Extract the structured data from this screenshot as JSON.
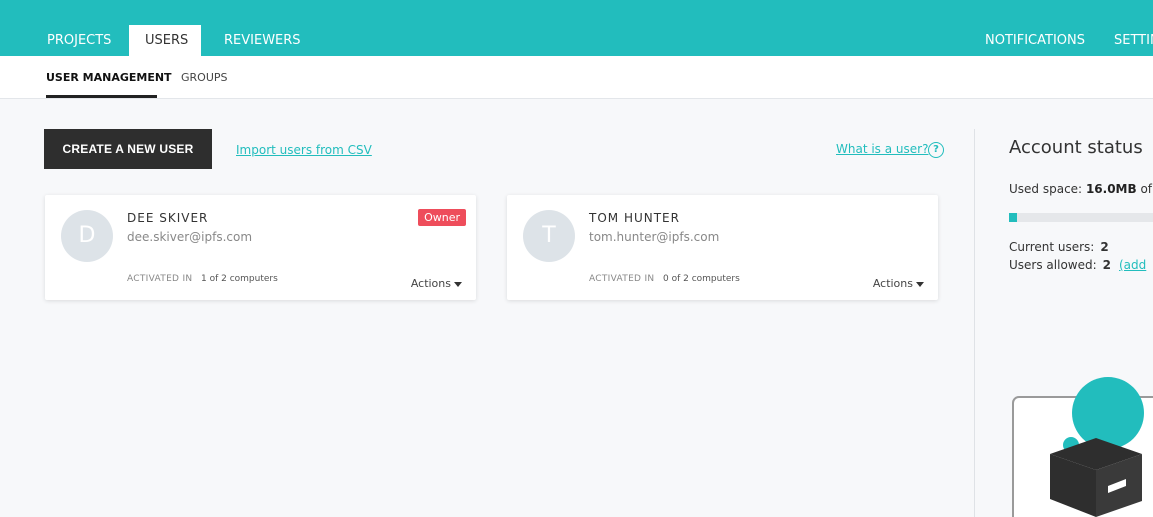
{
  "top_nav": {
    "tabs": [
      "PROJECTS",
      "USERS",
      "REVIEWERS"
    ],
    "active_tab": "USERS",
    "right_items": [
      "NOTIFICATIONS",
      "SETTIN"
    ]
  },
  "sub_nav": {
    "tabs": [
      "USER MANAGEMENT",
      "GROUPS"
    ],
    "active_tab": "USER MANAGEMENT"
  },
  "toolbar": {
    "create_label": "CREATE A NEW USER",
    "import_label": "Import users from CSV",
    "what_label": "What is a user?",
    "help_glyph": "?"
  },
  "users": [
    {
      "initial": "D",
      "name": "DEE SKIVER",
      "email": "dee.skiver@ipfs.com",
      "badge": "Owner",
      "activated_label": "ACTIVATED IN",
      "activated_value": "1 of 2 computers",
      "actions_label": "Actions"
    },
    {
      "initial": "T",
      "name": "TOM HUNTER",
      "email": "tom.hunter@ipfs.com",
      "badge": "",
      "activated_label": "ACTIVATED IN",
      "activated_value": "0 of 2 computers",
      "actions_label": "Actions"
    }
  ],
  "account_status": {
    "title": "Account status",
    "used_space_label": "Used space:",
    "used_space_value": "16.0MB",
    "used_space_suffix": "of",
    "usage_fraction": 0.05,
    "current_users_label": "Current users:",
    "current_users_value": "2",
    "users_allowed_label": "Users allowed:",
    "users_allowed_value": "2",
    "add_link": "(add"
  },
  "colors": {
    "accent": "#22bdbd",
    "dark": "#2e2e2e",
    "owner_badge": "#ee4d5b",
    "avatar_bg": "#dde3e8"
  },
  "icons": {
    "help": "question-circle-icon",
    "actions": "caret-down-icon",
    "illustration": "user-box-illustration"
  }
}
